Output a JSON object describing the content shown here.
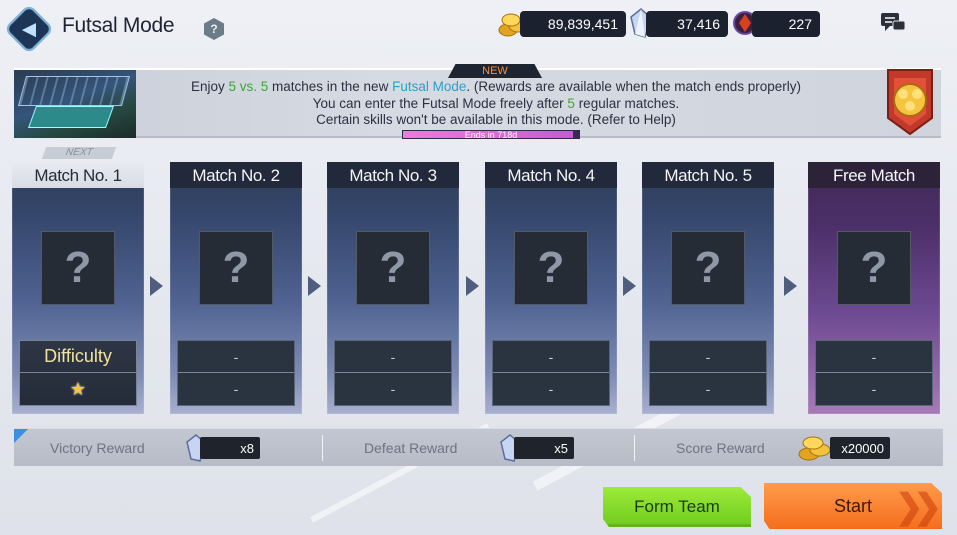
{
  "header": {
    "title": "Futsal Mode",
    "help_label": "?",
    "currencies": [
      {
        "icon": "gold-coins-icon",
        "value": "89,839,451"
      },
      {
        "icon": "crystal-icon",
        "value": "37,416"
      },
      {
        "icon": "red-gem-icon",
        "value": "227"
      }
    ]
  },
  "banner": {
    "new_label": "NEW",
    "line1_a": "Enjoy ",
    "line1_b": "5 vs. 5",
    "line1_c": " matches in the new ",
    "line1_d": "Futsal Mode",
    "line1_e": ". (Rewards are available when the match ends properly)",
    "line2_a": "You can enter the Futsal Mode freely after ",
    "line2_b": "5",
    "line2_c": " regular matches.",
    "line3": "Certain skills won't be available in this mode. (Refer to Help)",
    "ends": "Ends in 718d"
  },
  "next_label": "NEXT",
  "matches": [
    {
      "title": "Match No. 1",
      "difficulty_label": "Difficulty",
      "stars": "★"
    },
    {
      "title": "Match No. 2",
      "top": "-",
      "bottom": "-"
    },
    {
      "title": "Match No. 3",
      "top": "-",
      "bottom": "-"
    },
    {
      "title": "Match No. 4",
      "top": "-",
      "bottom": "-"
    },
    {
      "title": "Match No. 5",
      "top": "-",
      "bottom": "-"
    },
    {
      "title": "Free Match",
      "top": "-",
      "bottom": "-"
    }
  ],
  "mystery_glyph": "?",
  "rewards": {
    "victory_label": "Victory Reward",
    "victory_value": "x8",
    "defeat_label": "Defeat Reward",
    "defeat_value": "x5",
    "score_label": "Score Reward",
    "score_value": "x20000"
  },
  "buttons": {
    "form_team": "Form Team",
    "start": "Start"
  },
  "colors": {
    "form_team": "#7ed62a",
    "start": "#f77a28",
    "highlight_green": "#3aa836",
    "highlight_cyan": "#2aa0c8"
  }
}
